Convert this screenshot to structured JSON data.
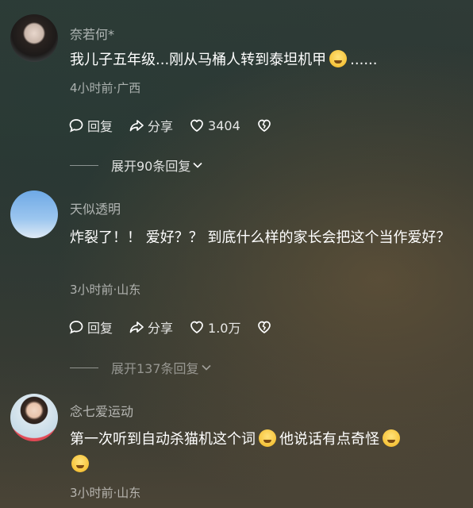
{
  "comments": [
    {
      "username": "奈若何*",
      "content_text": "我儿子五年级...刚从马桶人转到泰坦机甲",
      "content_tail": "......",
      "meta": "4小时前·广西",
      "reply_label": "回复",
      "share_label": "分享",
      "like_count": "3404",
      "expand_label": "展开90条回复"
    },
    {
      "username": "天似透明",
      "content_text": "炸裂了！！  爱好？？  到底什么样的家长会把这个当作爱好？",
      "meta": "3小时前·山东",
      "reply_label": "回复",
      "share_label": "分享",
      "like_count": "1.0万",
      "expand_label": "展开137条回复"
    },
    {
      "username": "念七爱运动",
      "content_text_1": "第一次听到自动杀猫机这个词",
      "content_text_2": "他说话有点奇怪",
      "meta": "3小时前·山东"
    }
  ]
}
